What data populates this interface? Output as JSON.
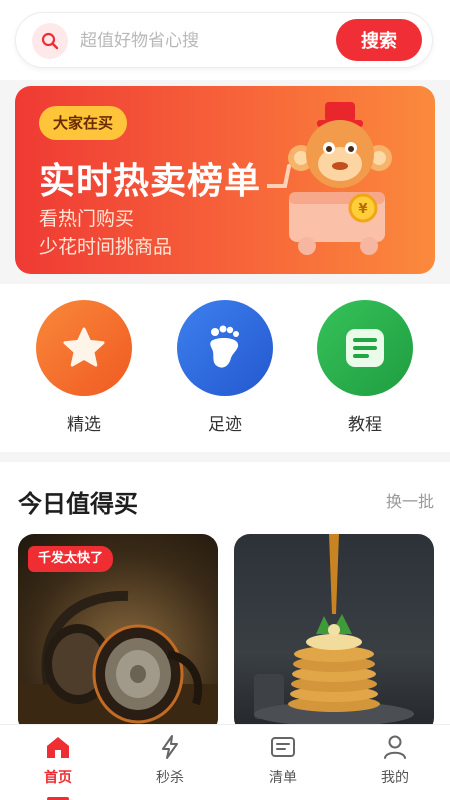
{
  "search": {
    "placeholder": "超值好物省心搜",
    "button_label": "搜索"
  },
  "banner": {
    "tag": "大家在买",
    "title": "实时热卖榜单",
    "subtitle_line1": "看热门购买",
    "subtitle_line2": "少花时间挑商品",
    "mascot_coin_symbol": "¥"
  },
  "categories": [
    {
      "label": "精选",
      "icon": "star-icon",
      "color": "#f56c2a"
    },
    {
      "label": "足迹",
      "icon": "footprint-icon",
      "color": "#2f6fe0"
    },
    {
      "label": "教程",
      "icon": "document-icon",
      "color": "#2bb24c"
    }
  ],
  "section": {
    "title": "今日值得买",
    "refresh_label": "换一批",
    "cards": [
      {
        "badge": "千发太快了",
        "image": "headphones-photo"
      },
      {
        "image": "pancakes-photo"
      }
    ]
  },
  "tabbar": {
    "items": [
      {
        "label": "首页",
        "icon": "home-icon",
        "active": true
      },
      {
        "label": "秒杀",
        "icon": "lightning-icon",
        "active": false
      },
      {
        "label": "清单",
        "icon": "list-icon",
        "active": false
      },
      {
        "label": "我的",
        "icon": "user-icon",
        "active": false
      }
    ]
  },
  "colors": {
    "accent": "#ee2e33",
    "banner_tag": "#ffc53a"
  }
}
